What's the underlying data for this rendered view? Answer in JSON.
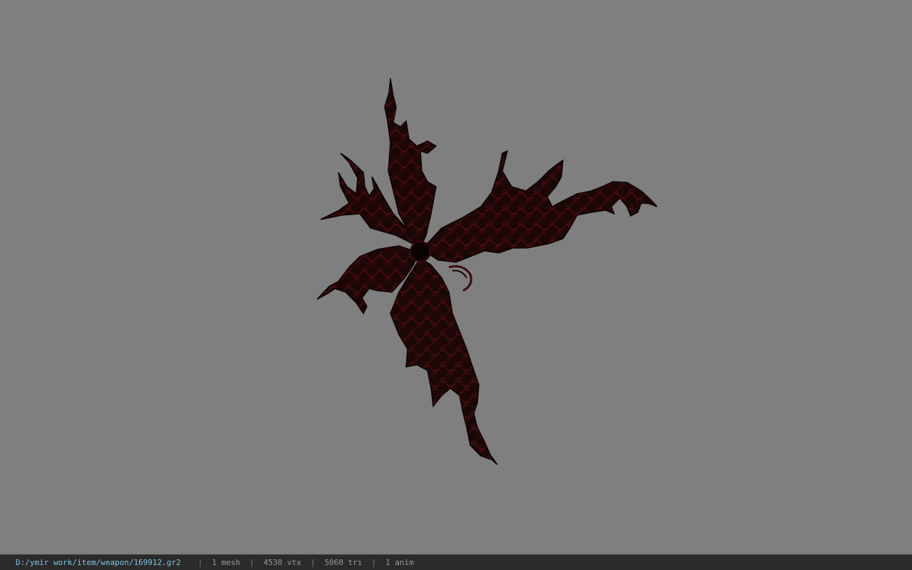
{
  "viewport": {
    "background_color": "#7f7f7f",
    "model": {
      "icon": "thorned-weapon-model",
      "base_color": "#1a0606",
      "accent_color": "#6a0f0f"
    }
  },
  "status_bar": {
    "path": "D:/ymir work/item/weapon/169912.gr2",
    "separator": "|",
    "mesh": "1 mesh",
    "vertices": "4530 vtx",
    "triangles": "5060 tri",
    "animations": "1 anim",
    "path_color": "#7fc6e6"
  }
}
